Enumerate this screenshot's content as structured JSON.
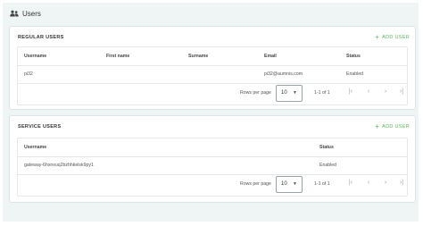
{
  "page": {
    "title": "Users",
    "icon": "users-icon"
  },
  "regular_users": {
    "title": "REGULAR USERS",
    "add_label": "ADD USER",
    "columns": [
      "Username",
      "First name",
      "Surname",
      "Email",
      "Status"
    ],
    "rows": [
      {
        "username": "pi32",
        "first_name": "",
        "surname": "",
        "email": "pi32@aumnis.com",
        "status": "Enabled"
      }
    ],
    "pagination": {
      "rows_per_page_label": "Rows per page",
      "rows_per_page": "10",
      "range": "1-1 of 1"
    }
  },
  "service_users": {
    "title": "SERVICE USERS",
    "add_label": "ADD USER",
    "columns": [
      "Username",
      "Status"
    ],
    "rows": [
      {
        "username": "gateway-6hxnxuq2bzhhkelsk9py1",
        "status": "Enabled"
      }
    ],
    "pagination": {
      "rows_per_page_label": "Rows per page",
      "rows_per_page": "10",
      "range": "1-1 of 1"
    }
  },
  "colors": {
    "accent": "#5cb85c",
    "background": "#eff4f5",
    "card": "#ffffff",
    "border": "#dde3e6"
  }
}
